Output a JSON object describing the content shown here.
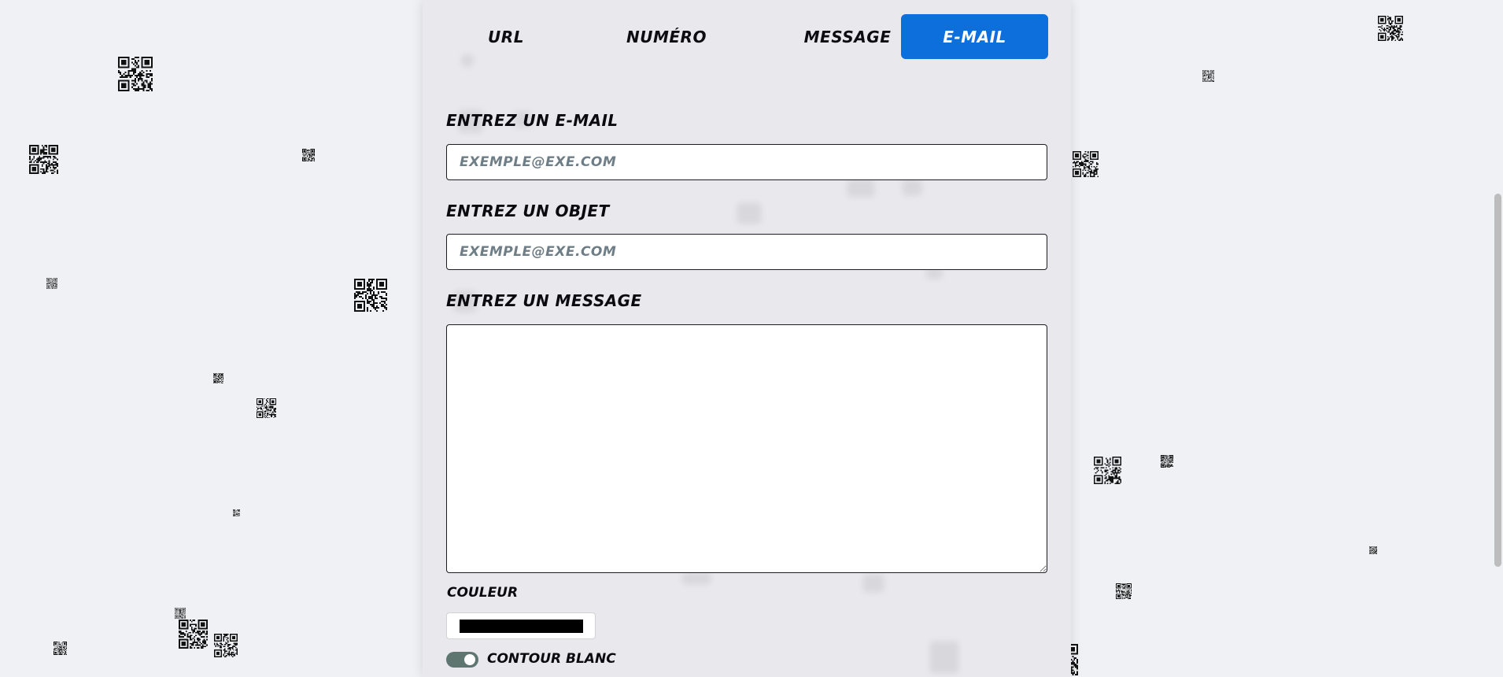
{
  "tabs": [
    {
      "label": "URL",
      "active": false
    },
    {
      "label": "NUMÉRO",
      "active": false
    },
    {
      "label": "MESSAGE",
      "active": false
    },
    {
      "label": "E-MAIL",
      "active": true
    }
  ],
  "form": {
    "email": {
      "label": "ENTREZ UN E-MAIL",
      "placeholder": "EXEMPLE@EXE.COM",
      "value": ""
    },
    "subject": {
      "label": "ENTREZ UN OBJET",
      "placeholder": "EXEMPLE@EXE.COM",
      "value": ""
    },
    "message": {
      "label": "ENTREZ UN MESSAGE",
      "value": ""
    },
    "color": {
      "label": "COULEUR",
      "value": "#000000"
    },
    "white_outline": {
      "label": "CONTOUR BLANC",
      "enabled": true
    }
  },
  "colors": {
    "accent": "#0c6fdc",
    "toggle_on": "#5f7670",
    "page_background": "#f0f1f4",
    "panel_background": "#e8e8ed"
  },
  "background": {
    "decoration": "scattered-qr-code-icons"
  }
}
